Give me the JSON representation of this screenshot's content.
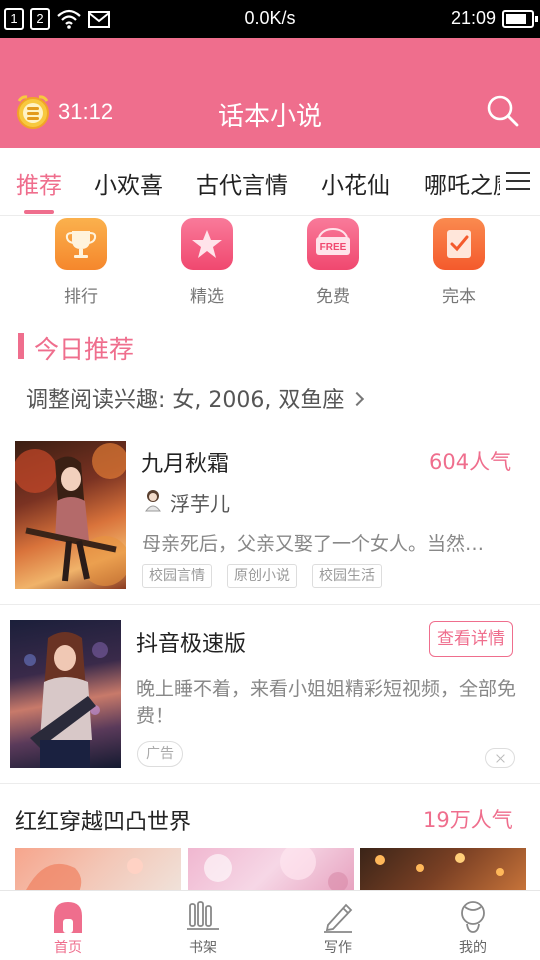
{
  "status_bar": {
    "sim1": "1",
    "sim2": "2",
    "speed": "0.0K/s",
    "time": "21:09",
    "battery_level": 0.85
  },
  "header": {
    "timer": "31:12",
    "title": "话本小说",
    "alarm_icon": "alarm-clock-icon",
    "search_icon": "search-icon"
  },
  "tabs": [
    "推荐",
    "小欢喜",
    "古代言情",
    "小花仙",
    "哪吒之魔童降世"
  ],
  "quick_entries": [
    {
      "label": "排行",
      "icon": "trophy-icon",
      "color": "#f99b3a"
    },
    {
      "label": "精选",
      "icon": "star-icon",
      "color": "#f3567d"
    },
    {
      "label": "免费",
      "icon": "free-icon",
      "color": "#f3567d"
    },
    {
      "label": "完本",
      "icon": "check-book-icon",
      "color": "#f6653b"
    }
  ],
  "section": {
    "title": "今日推荐",
    "interest": "调整阅读兴趣: 女, 2006, 双鱼座"
  },
  "book1": {
    "title": "九月秋霜",
    "popularity": "604人气",
    "author": "浮芋儿",
    "description": "母亲死后，父亲又娶了一个女人。当然…",
    "tags": [
      "校园言情",
      "原创小说",
      "校园生活"
    ]
  },
  "ad": {
    "title": "抖音极速版",
    "button": "查看详情",
    "description": "晚上睡不着，来看小姐姐精彩短视频，全部免费！",
    "tag": "广告"
  },
  "book2": {
    "title": "红红穿越凹凸世界",
    "popularity": "19万人气"
  },
  "bottom_nav": [
    {
      "label": "首页",
      "icon": "home-icon",
      "active": true
    },
    {
      "label": "书架",
      "icon": "bookshelf-icon",
      "active": false
    },
    {
      "label": "写作",
      "icon": "pen-icon",
      "active": false
    },
    {
      "label": "我的",
      "icon": "profile-icon",
      "active": false
    }
  ],
  "colors": {
    "accent": "#ef6e8d",
    "status_bar": "#000000"
  }
}
